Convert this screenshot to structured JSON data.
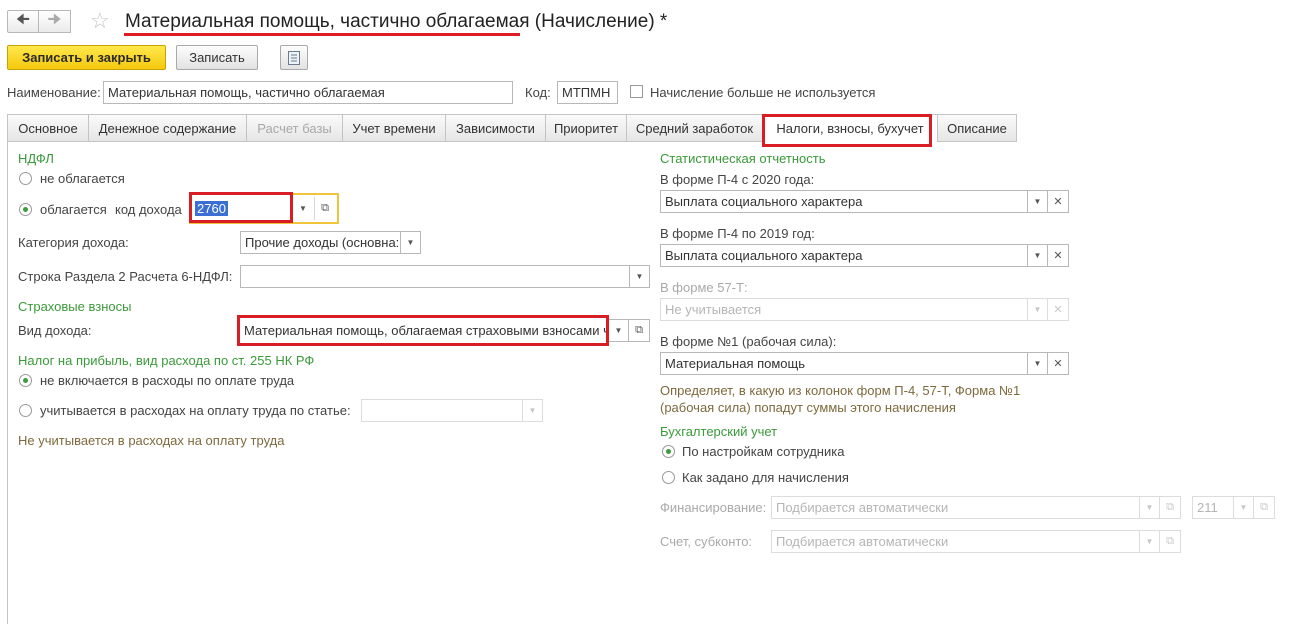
{
  "header": {
    "back_icon": "arrow-left-icon",
    "forward_icon": "arrow-right-icon",
    "favorite_icon": "star-icon",
    "title_main": "Материальная помощь, частично облагаемая",
    "title_rest": " (Начисление) *"
  },
  "toolbar": {
    "save_close_label": "Записать и закрыть",
    "save_label": "Записать",
    "menu_icon": "document-list-icon"
  },
  "form": {
    "name_label": "Наименование:",
    "name_value": "Материальная помощь, частично облагаемая",
    "code_label": "Код:",
    "code_value": "МТПМН",
    "unused_label": "Начисление больше не используется"
  },
  "tabs": [
    {
      "label": "Основное"
    },
    {
      "label": "Денежное содержание"
    },
    {
      "label": "Расчет базы"
    },
    {
      "label": "Учет времени"
    },
    {
      "label": "Зависимости"
    },
    {
      "label": "Приоритет"
    },
    {
      "label": "Средний заработок"
    },
    {
      "label": "Налоги, взносы, бухучет"
    },
    {
      "label": "Описание"
    }
  ],
  "ndfl": {
    "title": "НДФЛ",
    "not_taxed": "не облагается",
    "taxed": "облагается",
    "income_code_label": "код дохода",
    "income_code_value": "2760",
    "category_label": "Категория дохода:",
    "category_value": "Прочие доходы (основна:",
    "row6_label": "Строка Раздела 2 Расчета 6-НДФЛ:",
    "row6_value": ""
  },
  "insurance": {
    "title": "Страховые взносы",
    "income_kind_label": "Вид дохода:",
    "income_kind_value": "Материальная помощь, облагаемая страховыми взносами ч"
  },
  "profit_tax": {
    "title": "Налог на прибыль, вид расхода по ст. 255 НК РФ",
    "opt1": "не включается в расходы по оплате труда",
    "opt2": "учитывается в расходах на оплату труда по статье:",
    "opt2_value": "",
    "note": "Не учитывается в расходах на оплату труда"
  },
  "stats": {
    "title": "Статистическая отчетность",
    "p4_2020_label": "В форме П-4 с 2020 года:",
    "p4_2020_value": "Выплата социального характера",
    "p4_2019_label": "В форме П-4 по 2019 год:",
    "p4_2019_value": "Выплата социального характера",
    "f57_label": "В форме 57-Т:",
    "f57_value": "Не учитывается",
    "f1_label": "В форме №1 (рабочая сила):",
    "f1_value": "Материальная помощь",
    "note_line1": "Определяет, в какую из колонок форм П-4, 57-Т, Форма №1",
    "note_line2": "(рабочая сила) попадут суммы этого начисления"
  },
  "accounting": {
    "title": "Бухгалтерский учет",
    "opt1": "По настройкам сотрудника",
    "opt2": "Как задано для начисления",
    "financing_label": "Финансирование:",
    "financing_value": "Подбирается автоматически",
    "article_value": "211",
    "account_label": "Счет, субконто:",
    "account_value": "Подбирается автоматически"
  }
}
